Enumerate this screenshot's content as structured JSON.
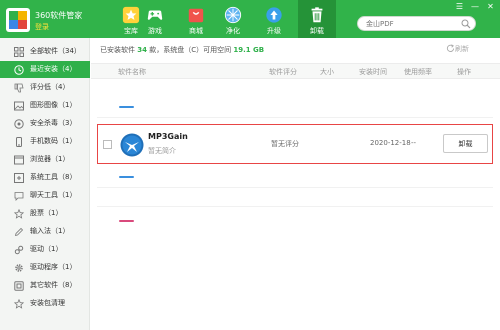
{
  "app": {
    "title": "360软件管家",
    "login_label": "登录"
  },
  "nav": [
    {
      "label": "宝库",
      "icon": "star-icon"
    },
    {
      "label": "游戏",
      "icon": "gamepad-icon"
    },
    {
      "label": "商城",
      "icon": "shopping-bag-icon"
    },
    {
      "label": "净化",
      "icon": "compass-icon"
    },
    {
      "label": "升级",
      "icon": "upload-icon"
    },
    {
      "label": "卸载",
      "icon": "trash-icon",
      "active": true
    }
  ],
  "search": {
    "placeholder": "金山PDF"
  },
  "window_controls": [
    "☰",
    "—",
    "✕"
  ],
  "sidebar": {
    "items": [
      {
        "label": "全部软件（34）",
        "icon": "grid-icon"
      },
      {
        "label": "最近安装（4）",
        "icon": "clock-icon",
        "active": true
      },
      {
        "label": "评分低（4）",
        "icon": "thumbs-down-icon"
      },
      {
        "label": "图形图像（1）",
        "icon": "image-icon"
      },
      {
        "label": "安全杀毒（3）",
        "icon": "shield-icon"
      },
      {
        "label": "手机数码（1）",
        "icon": "phone-icon"
      },
      {
        "label": "浏览器（1）",
        "icon": "browser-icon"
      },
      {
        "label": "系统工具（8）",
        "icon": "tools-icon"
      },
      {
        "label": "聊天工具（1）",
        "icon": "chat-icon"
      },
      {
        "label": "股票（1）",
        "icon": "star-outline-icon"
      },
      {
        "label": "输入法（1）",
        "icon": "pen-icon"
      },
      {
        "label": "驱动（1）",
        "icon": "link-icon"
      },
      {
        "label": "驱动程序（1）",
        "icon": "gear-icon"
      },
      {
        "label": "其它软件（8）",
        "icon": "box-icon"
      },
      {
        "label": "安装包清理",
        "icon": "star-outline-icon"
      }
    ]
  },
  "summary": {
    "prefix": "已安装软件",
    "count": "34",
    "middle": "款，系统盘（C）可用空间",
    "free_space": "19.1 GB"
  },
  "refresh_label": "刷新",
  "table": {
    "headers": [
      "软件名称",
      "软件评分",
      "大小",
      "安装时间",
      "使用频率",
      "操作"
    ]
  },
  "row": {
    "name": "MP3Gain",
    "description": "暂无简介",
    "rating": "暂无评分",
    "date": "2020-12-18",
    "frequency": "--",
    "action": "卸载"
  },
  "colors": {
    "brand": "#31b34a",
    "active_nav": "#259338",
    "highlight_border": "#e84545"
  }
}
